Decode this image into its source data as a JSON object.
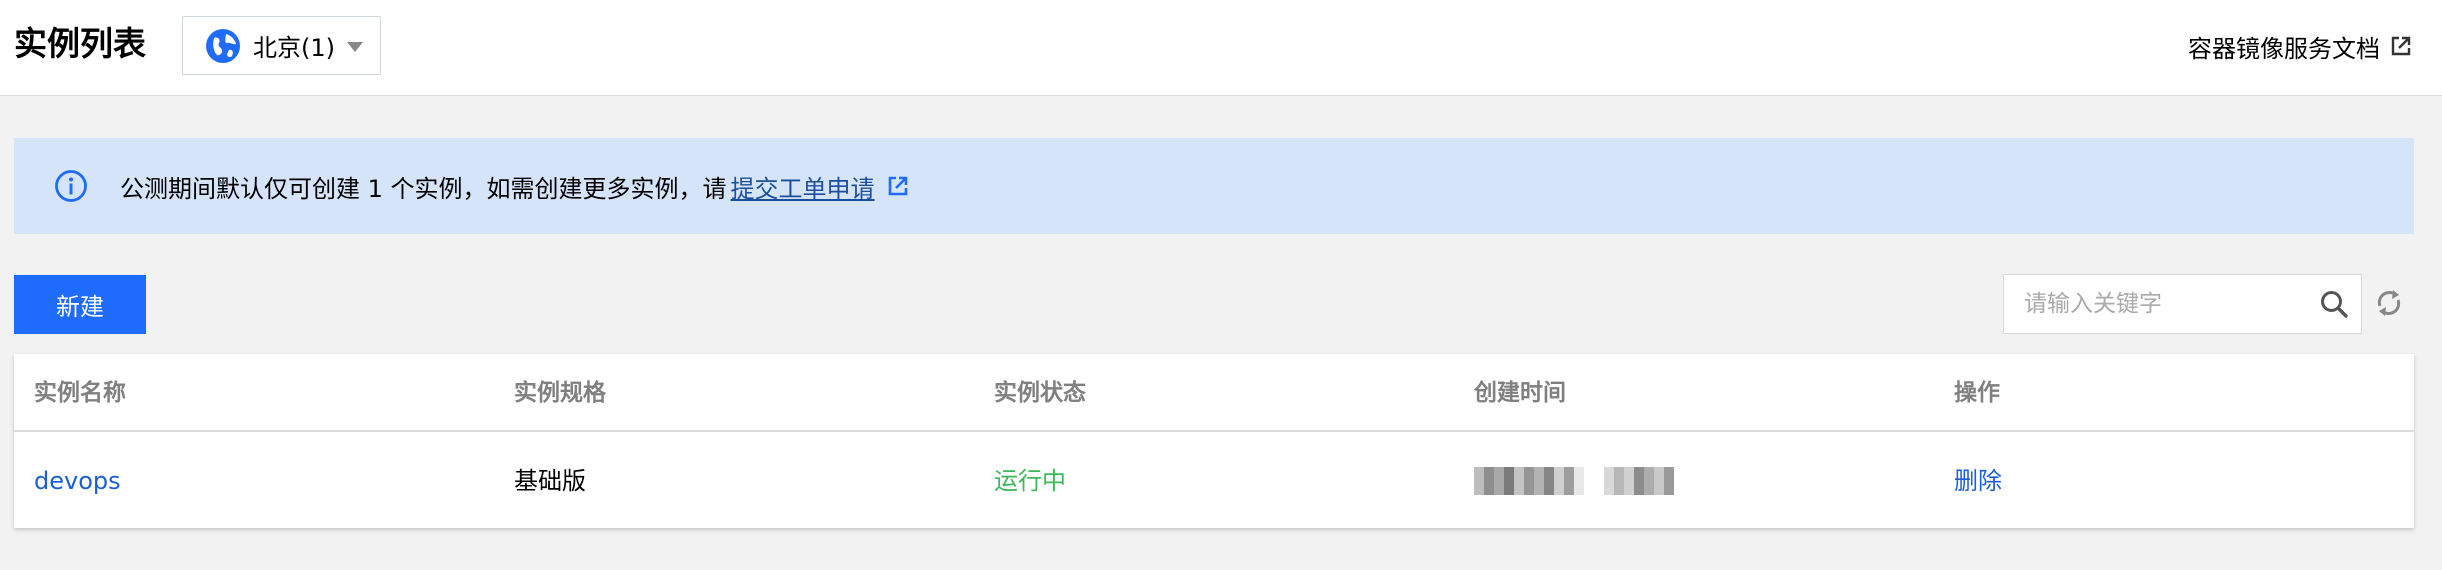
{
  "header": {
    "title": "实例列表",
    "region": "北京(1)",
    "doc_link": "容器镜像服务文档"
  },
  "notice": {
    "text": "公测期间默认仅可创建 1 个实例，如需创建更多实例，请",
    "link": "提交工单申请"
  },
  "toolbar": {
    "new_label": "新建",
    "search_placeholder": "请输入关键字"
  },
  "table": {
    "columns": [
      "实例名称",
      "实例规格",
      "实例状态",
      "创建时间",
      "操作"
    ],
    "rows": [
      {
        "name": "devops",
        "spec": "基础版",
        "status": "运行中",
        "action": "删除"
      }
    ]
  },
  "colors": {
    "accent": "#1f6bfb",
    "link": "#1a5fd8",
    "running": "#3db85b",
    "notice_bg": "#d6e4fa"
  },
  "icons": [
    "globe-icon",
    "chevron-down-icon",
    "external-link-icon",
    "info-icon",
    "search-icon",
    "refresh-icon"
  ]
}
